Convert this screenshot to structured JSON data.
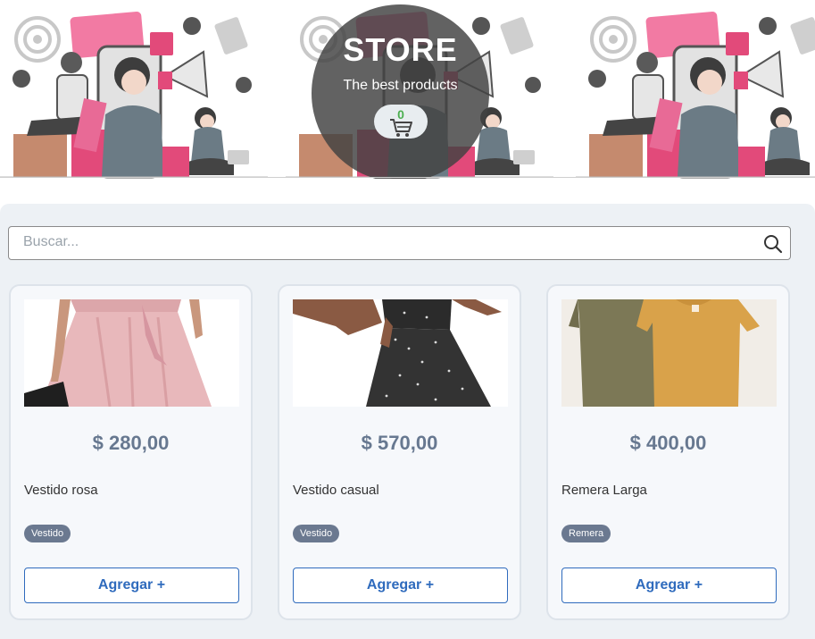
{
  "header": {
    "title": "STORE",
    "subtitle": "The best products",
    "cart_count": "0",
    "icons": [
      "cart-icon"
    ]
  },
  "search": {
    "placeholder": "Buscar...",
    "icon": "search-icon"
  },
  "products": [
    {
      "price": "$ 280,00",
      "name": "Vestido rosa",
      "tag": "Vestido",
      "button": "Agregar +"
    },
    {
      "price": "$ 570,00",
      "name": "Vestido casual",
      "tag": "Vestido",
      "button": "Agregar +"
    },
    {
      "price": "$ 400,00",
      "name": "Remera Larga",
      "tag": "Remera",
      "button": "Agregar +"
    }
  ],
  "colors": {
    "accent": "#2f6bbd",
    "price": "#677890",
    "tag_bg": "#6b7990",
    "cart_count": "#4caf50",
    "panel_bg": "#edf1f5"
  }
}
